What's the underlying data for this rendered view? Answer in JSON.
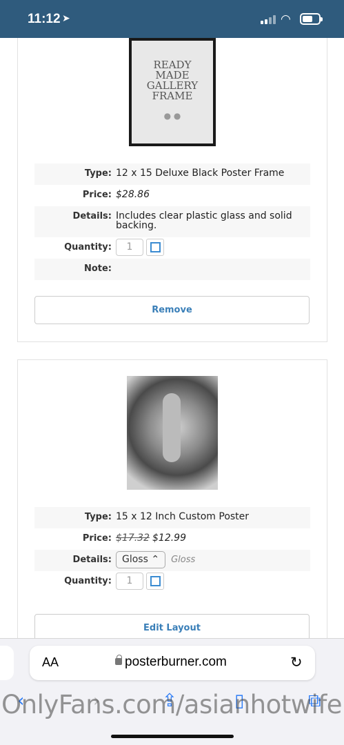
{
  "status_bar": {
    "time": "11:12",
    "location_icon": "location-arrow-icon",
    "signal_icon": "signal-icon",
    "wifi_icon": "wifi-icon",
    "battery_icon": "battery-icon"
  },
  "item1": {
    "frame_text": [
      "READY",
      "MADE",
      "GALLERY",
      "FRAME"
    ],
    "type_label": "Type:",
    "type": "12 x 15 Deluxe Black Poster Frame",
    "price_label": "Price:",
    "price": "$28.86",
    "details_label": "Details:",
    "details": "Includes clear plastic glass and solid backing.",
    "quantity_label": "Quantity:",
    "quantity": "1",
    "note_label": "Note:",
    "remove_button": "Remove"
  },
  "item2": {
    "type_label": "Type:",
    "type": "15 x 12 Inch Custom Poster",
    "price_label": "Price:",
    "old_price": "$17.32",
    "price": "$12.99",
    "details_label": "Details:",
    "finish_option": "Gloss",
    "finish_note": "Gloss",
    "quantity_label": "Quantity:",
    "quantity": "1",
    "edit_button": "Edit Layout"
  },
  "browser": {
    "aa": "AA",
    "domain": "posterburner.com"
  },
  "watermark": "OnlyFans.com/asianhotwife"
}
